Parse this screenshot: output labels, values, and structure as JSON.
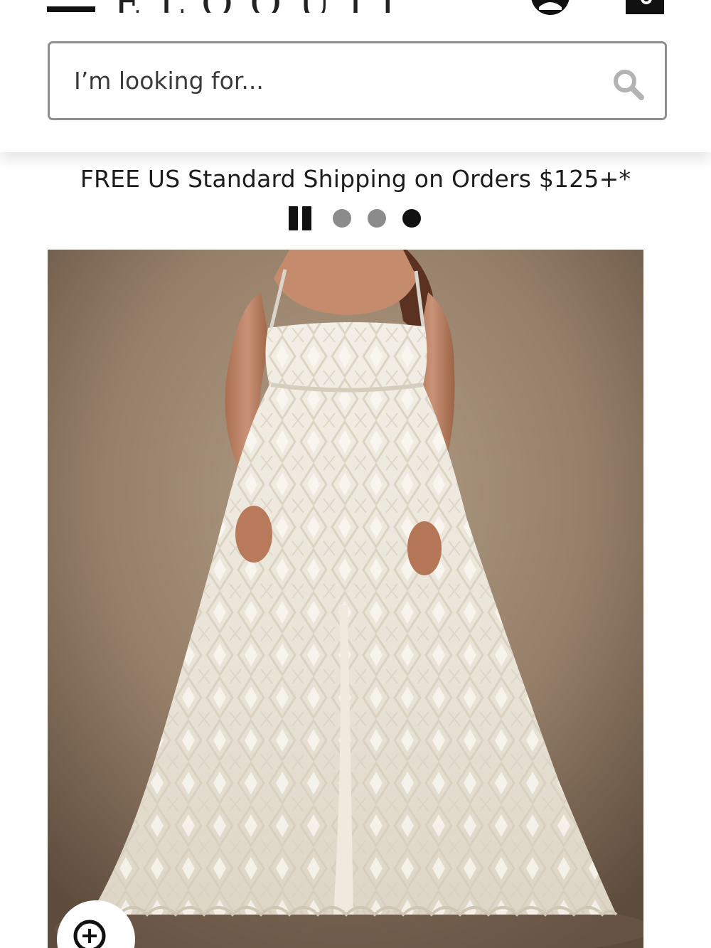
{
  "header": {
    "logo_text": "ELOQUII",
    "menu_icon": "hamburger-menu-icon",
    "account_icon": "account-icon",
    "bag_icon": "shopping-bag-icon"
  },
  "search": {
    "placeholder": "I’m looking for...",
    "icon": "search-icon"
  },
  "promo": {
    "text": "FREE US Standard Shipping on Orders $125+*"
  },
  "carousel": {
    "pause_icon": "pause-icon",
    "slides": [
      {
        "active": false,
        "color": "#8b8b8b"
      },
      {
        "active": false,
        "color": "#8b8b8b"
      },
      {
        "active": true,
        "color": "#111111"
      }
    ]
  },
  "product": {
    "image_subject": "model in white sequin maxi wedding gown",
    "zoom_icon": "zoom-in-icon"
  },
  "colors": {
    "background": "#ffffff",
    "text": "#1c1c1c",
    "search_border": "#8e8e8e",
    "photo_backdrop": "#8a7763"
  }
}
